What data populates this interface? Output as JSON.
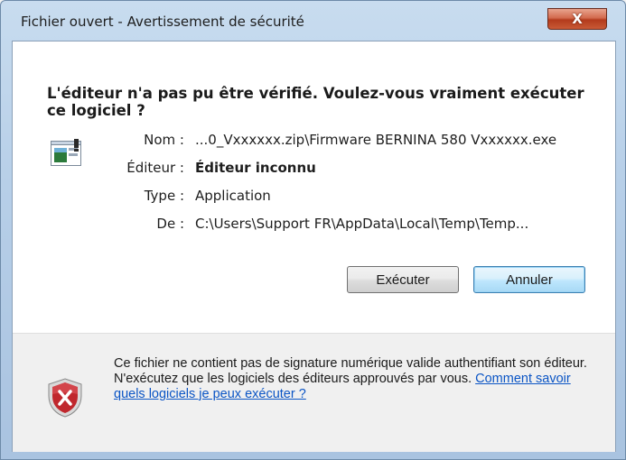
{
  "window": {
    "title": "Fichier ouvert - Avertissement de sécurité",
    "close_label": "X"
  },
  "dialog": {
    "heading": "L'éditeur n'a pas pu être vérifié. Voulez-vous vraiment exécuter ce logiciel ?",
    "details": [
      {
        "label": "Nom :",
        "value": "...0_Vxxxxxx.zip\\Firmware BERNINA 580 Vxxxxxx.exe",
        "bold": false
      },
      {
        "label": "Éditeur :",
        "value": "Éditeur inconnu",
        "bold": true
      },
      {
        "label": "Type :",
        "value": "Application",
        "bold": false
      },
      {
        "label": "De :",
        "value": "C:\\Users\\Support FR\\AppData\\Local\\Temp\\Temp...",
        "bold": false
      }
    ],
    "buttons": {
      "run": "Exécuter",
      "cancel": "Annuler"
    }
  },
  "footer": {
    "text": "Ce fichier ne contient pas de signature numérique valide authentifiant son éditeur. N'exécutez que les logiciels des éditeurs approuvés par vous.",
    "link": "Comment savoir quels logiciels je peux exécuter ?"
  },
  "colors": {
    "link": "#0b55c5",
    "shield_red": "#c0272d"
  }
}
